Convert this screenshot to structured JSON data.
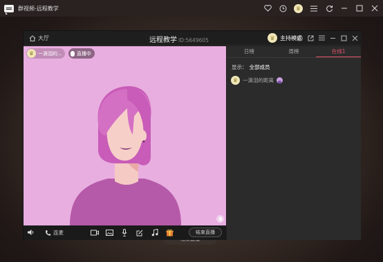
{
  "app": {
    "title": "群视频-远程教学"
  },
  "app_controls": [
    "heart-icon",
    "clock-icon",
    "avatar",
    "menu-icon",
    "refresh-icon",
    "minimize-icon",
    "maximize-icon",
    "close-icon"
  ],
  "window": {
    "home_label": "大厅",
    "title": "远程教学",
    "room_id": "ID:5649605",
    "host_mode_label": "主持模式"
  },
  "video": {
    "user_name": "一滴泪的...",
    "live_label": "直播中"
  },
  "toolbar": {
    "mic_label": "连麦",
    "end_live_label": "结束直播"
  },
  "side": {
    "tabs": [
      {
        "label": "日榜"
      },
      {
        "label": "周榜"
      },
      {
        "label": "在线1"
      }
    ],
    "active_tab": 2,
    "show_label": "显示：",
    "show_value": "全部成员",
    "members": [
      {
        "name": "一滴泪的距离"
      }
    ]
  },
  "background": {
    "faded_button_label": "结束直播"
  },
  "colors": {
    "accent": "#e6566c",
    "video_bg": "#e8aee0",
    "window_bg": "#1e1e1e"
  }
}
